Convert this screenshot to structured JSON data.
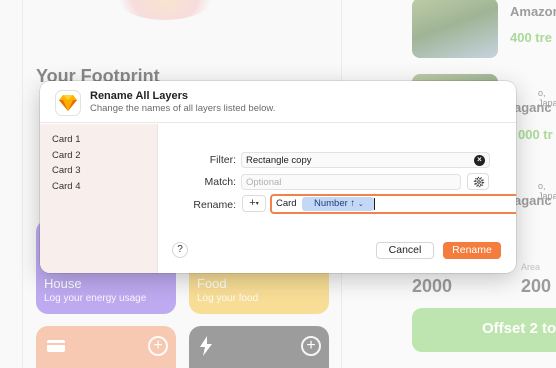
{
  "background": {
    "section_title": "Your Footprint",
    "cards": [
      {
        "title": "House",
        "subtitle": "Log your energy usage",
        "color": "#8d6de6"
      },
      {
        "title": "Food",
        "subtitle": "Log your food",
        "color": "#f3c44b"
      },
      {
        "title": "",
        "subtitle": "",
        "color": "#f1a27a"
      },
      {
        "title": "",
        "subtitle": "",
        "color": "#555555"
      }
    ],
    "right": {
      "place1": "Amazon",
      "trees1": "400 tre",
      "place2_loc": "o, Japa",
      "place2": "aganc",
      "trees2": "000 tr",
      "place3_loc": "o, Japa",
      "place3": "aganc",
      "area_label": "Area",
      "stat1": "2000",
      "stat2": "200",
      "offset_button": "Offset 2 to"
    }
  },
  "dialog": {
    "title": "Rename All Layers",
    "subtitle": "Change the names of all layers listed below.",
    "layers": [
      "Card 1",
      "Card 2",
      "Card 3",
      "Card 4"
    ],
    "filter_label": "Filter:",
    "filter_value": "Rectangle copy",
    "match_label": "Match:",
    "match_placeholder": "Optional",
    "rename_label": "Rename:",
    "add_token_button": "+",
    "rename_prefix": "Card",
    "rename_token": "Number ↑",
    "help_button": "?",
    "cancel_button": "Cancel",
    "rename_button": "Rename",
    "accent_color": "#f47c3c"
  }
}
